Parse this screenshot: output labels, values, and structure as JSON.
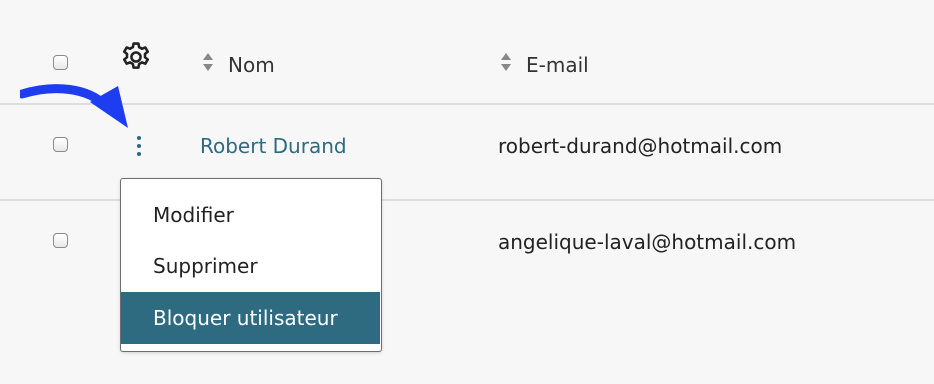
{
  "header": {
    "columns": [
      {
        "label": "Nom"
      },
      {
        "label": "E-mail"
      }
    ]
  },
  "rows": [
    {
      "name": "Robert Durand",
      "email": "robert-durand@hotmail.com"
    },
    {
      "name": "",
      "email": "angelique-laval@hotmail.com"
    }
  ],
  "context_menu": {
    "items": [
      {
        "label": "Modifier"
      },
      {
        "label": "Supprimer"
      },
      {
        "label": "Bloquer utilisateur",
        "highlighted": true
      }
    ]
  },
  "icons": {
    "settings": "gear-icon",
    "sort": "sort-icon",
    "row_actions": "kebab-menu-icon",
    "annotation": "arrow-icon"
  },
  "colors": {
    "accent": "#2e6a80",
    "annotation_arrow": "#1f3df0"
  }
}
